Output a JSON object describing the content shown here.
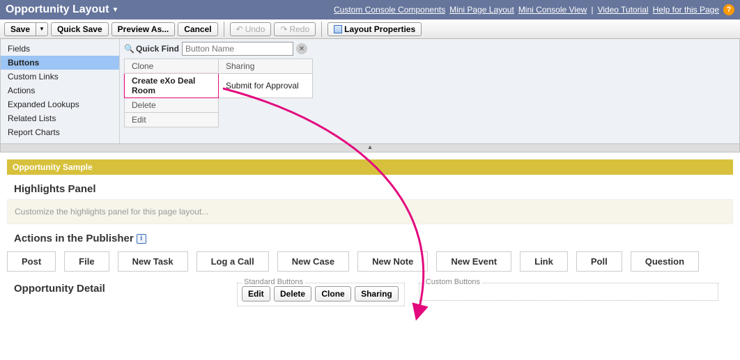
{
  "header": {
    "title": "Opportunity Layout",
    "links": {
      "custom_console": "Custom Console Components",
      "mini_page": "Mini Page Layout",
      "mini_console": "Mini Console View",
      "video": "Video Tutorial",
      "help": "Help for this Page"
    }
  },
  "toolbar": {
    "save": "Save",
    "quick_save": "Quick Save",
    "preview_as": "Preview As...",
    "cancel": "Cancel",
    "undo": "Undo",
    "redo": "Redo",
    "layout_props": "Layout Properties"
  },
  "palette": {
    "nav": {
      "fields": "Fields",
      "buttons": "Buttons",
      "custom_links": "Custom Links",
      "actions": "Actions",
      "expanded_lookups": "Expanded Lookups",
      "related_lists": "Related Lists",
      "report_charts": "Report Charts"
    },
    "quick_find": {
      "label": "Quick Find",
      "placeholder": "Button Name"
    },
    "items": {
      "clone": "Clone",
      "sharing": "Sharing",
      "create_exo": "Create eXo Deal Room",
      "submit_approval": "Submit for Approval",
      "delete": "Delete",
      "edit": "Edit"
    }
  },
  "canvas": {
    "sample_header": "Opportunity Sample",
    "highlights_title": "Highlights Panel",
    "highlights_placeholder": "Customize the highlights panel for this page layout...",
    "actions_title": "Actions in the Publisher",
    "actions": {
      "post": "Post",
      "file": "File",
      "new_task": "New Task",
      "log_call": "Log a Call",
      "new_case": "New Case",
      "new_note": "New Note",
      "new_event": "New Event",
      "link": "Link",
      "poll": "Poll",
      "question": "Question"
    },
    "detail_title": "Opportunity Detail",
    "std_buttons_legend": "Standard Buttons",
    "custom_buttons_legend": "Custom Buttons",
    "std_buttons": {
      "edit": "Edit",
      "delete": "Delete",
      "clone": "Clone",
      "sharing": "Sharing"
    }
  }
}
